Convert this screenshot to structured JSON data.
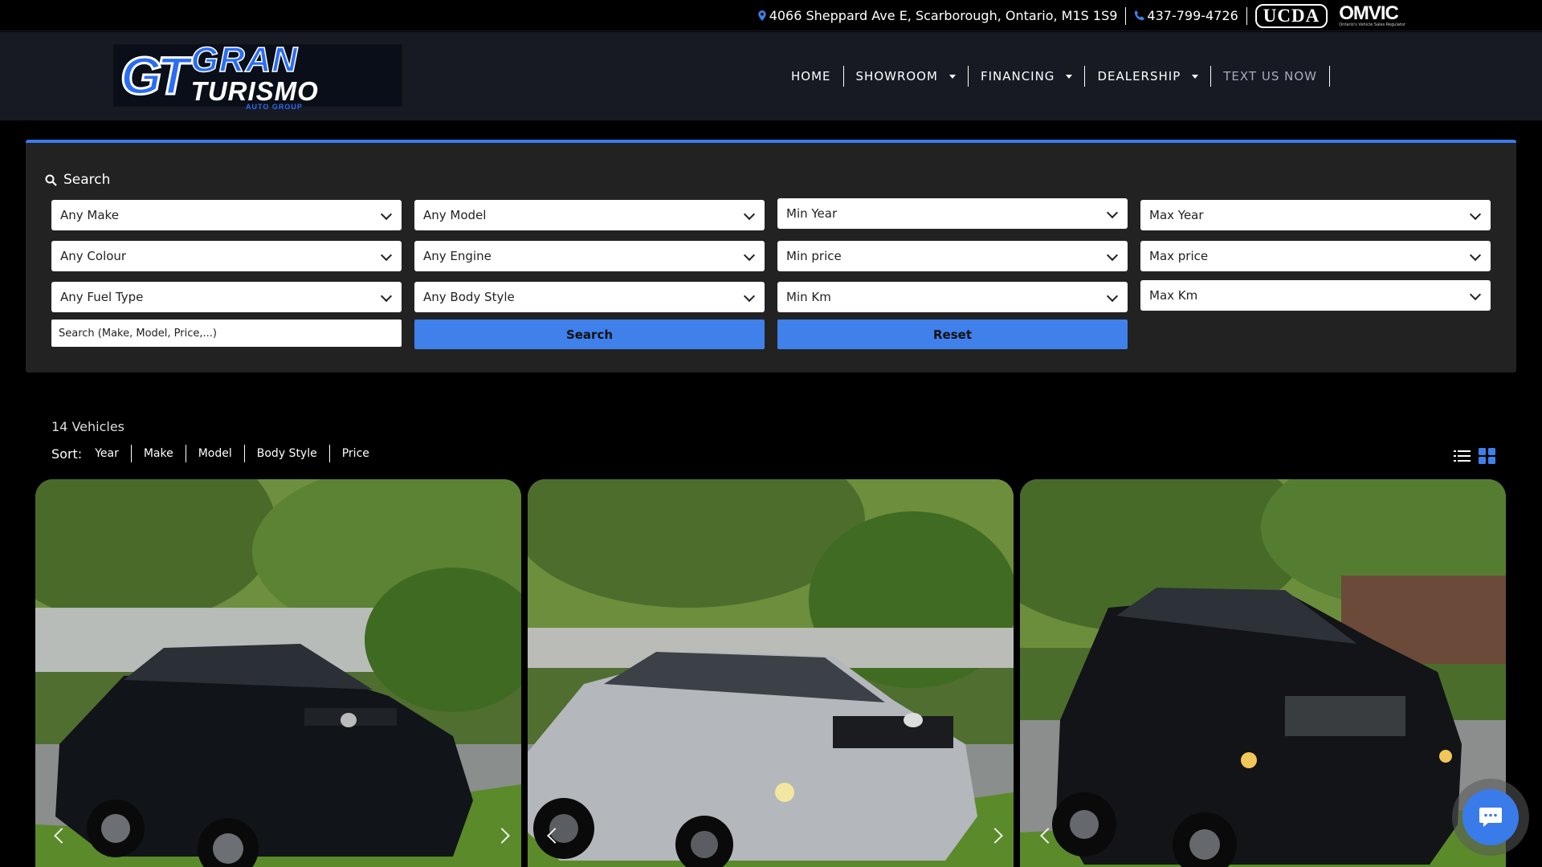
{
  "topbar": {
    "address": "4066 Sheppard Ave E, Scarborough, Ontario, M1S 1S9",
    "phone": "437-799-4726",
    "badge_ucda": "UCDA",
    "badge_omvic": "OMVIC",
    "badge_omvic_tagline": "Ontario's Vehicle Sales Regulator"
  },
  "logo": {
    "mark": "GT",
    "line1": "GRAN",
    "line2": "TURISMO",
    "line3": "AUTO GROUP"
  },
  "nav": {
    "home": "HOME",
    "showroom": "SHOWROOM",
    "financing": "FINANCING",
    "dealership": "DEALERSHIP",
    "text_us": "TEXT US NOW"
  },
  "search": {
    "title": "Search",
    "make": "Any Make",
    "model": "Any Model",
    "min_year": "Min Year",
    "max_year": "Max Year",
    "colour": "Any Colour",
    "engine": "Any Engine",
    "min_price": "Min price",
    "max_price": "Max price",
    "fuel": "Any Fuel Type",
    "body": "Any Body Style",
    "min_km": "Min Km",
    "max_km": "Max Km",
    "keyword_placeholder": "Search (Make, Model, Price,...)",
    "search_button": "Search",
    "reset_button": "Reset"
  },
  "results": {
    "count": "14 Vehicles",
    "sort_label": "Sort:",
    "sort_options": [
      "Year",
      "Make",
      "Model",
      "Body Style",
      "Price"
    ]
  },
  "colors": {
    "accent": "#3f80ea",
    "header_bg": "#171a22",
    "panel_bg": "#222222"
  },
  "icons": [
    "map-pin-icon",
    "phone-icon",
    "search-icon",
    "list-view-icon",
    "grid-view-icon",
    "chat-icon",
    "chevron-left-icon",
    "chevron-right-icon"
  ]
}
